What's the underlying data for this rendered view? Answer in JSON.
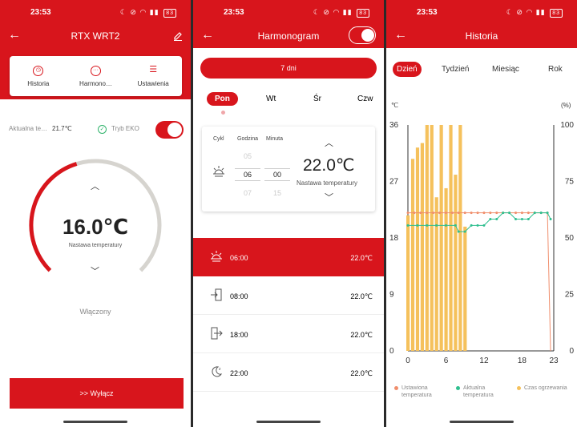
{
  "status_time": "23:53",
  "battery": "83",
  "colors": {
    "accent": "#d8151c",
    "setpoint": "#f08e6c",
    "actual": "#2fbf8f",
    "heating": "#f5c15c"
  },
  "screen1": {
    "title": "RTX WRT2",
    "tabs": [
      {
        "label": "Historia",
        "icon": "clock-icon"
      },
      {
        "label": "Harmono…",
        "icon": "dots-icon"
      },
      {
        "label": "Ustawienia",
        "icon": "menu-lines-icon"
      }
    ],
    "current_label": "Aktualna te…",
    "current_value": "21.7℃",
    "eko_label": "Tryb EKO",
    "eko_on": true,
    "setpoint": "16.0℃",
    "setpoint_label": "Nastawa temperatury",
    "state": "Włączony",
    "off_button": ">>  Wyłącz"
  },
  "screen2": {
    "title": "Harmonogram",
    "enabled": true,
    "days_button": "7 dni",
    "days": [
      "Pon",
      "Wt",
      "Śr",
      "Czw"
    ],
    "active_day": "Pon",
    "editor": {
      "col_cycle": "Cykl",
      "col_hour": "Godzina",
      "col_minute": "Minuta",
      "hour_prev": "05",
      "hour": "06",
      "hour_next": "07",
      "minute": "00",
      "minute_next": "15",
      "temp": "22.0℃",
      "temp_label": "Nastawa temperatury"
    },
    "schedule": [
      {
        "icon": "sunrise-icon",
        "time": "06:00",
        "temp": "22.0℃",
        "active": true
      },
      {
        "icon": "door-enter-icon",
        "time": "08:00",
        "temp": "22.0℃",
        "active": false
      },
      {
        "icon": "door-exit-icon",
        "time": "18:00",
        "temp": "22.0℃",
        "active": false
      },
      {
        "icon": "moon-icon",
        "time": "22:00",
        "temp": "22.0℃",
        "active": false
      }
    ]
  },
  "screen3": {
    "title": "Historia",
    "ranges": [
      "Dzień",
      "Tydzień",
      "Miesiąc",
      "Rok"
    ],
    "active_range": "Dzień",
    "legend": [
      "Ustawiona temperatura",
      "Aktualna temperatura",
      "Czas ogrzewania"
    ]
  },
  "chart_data": {
    "type": "bar",
    "left_axis_label": "℃",
    "right_axis_label": "(%)",
    "left_ylim": [
      0,
      36
    ],
    "right_ylim": [
      0,
      100
    ],
    "left_ticks": [
      "0",
      "9",
      "18",
      "27",
      "36"
    ],
    "right_ticks": [
      "0",
      "25",
      "50",
      "75",
      "100"
    ],
    "x_ticks": [
      "0",
      "6",
      "12",
      "18",
      "23"
    ],
    "xlim": [
      0,
      23
    ],
    "heating_x": [
      0,
      0.75,
      1.5,
      2.25,
      3,
      3.75,
      4.5,
      5.25,
      6,
      6.75,
      7.5,
      8.25,
      9
    ],
    "heating_pct": [
      60,
      85,
      90,
      92,
      100,
      100,
      68,
      100,
      72,
      100,
      78,
      100,
      55
    ],
    "setpoint": [
      [
        0,
        22
      ],
      [
        22,
        22
      ],
      [
        22.5,
        0
      ]
    ],
    "actual": [
      [
        0,
        20
      ],
      [
        1.5,
        20
      ],
      [
        3,
        20
      ],
      [
        4.5,
        20
      ],
      [
        6,
        20
      ],
      [
        7.5,
        20
      ],
      [
        8,
        19
      ],
      [
        9,
        19
      ],
      [
        10,
        20
      ],
      [
        11,
        20
      ],
      [
        12,
        20
      ],
      [
        13,
        21
      ],
      [
        14,
        21
      ],
      [
        15,
        22
      ],
      [
        16,
        22
      ],
      [
        17,
        21
      ],
      [
        18,
        21
      ],
      [
        19,
        21
      ],
      [
        20,
        22
      ],
      [
        21,
        22
      ],
      [
        22,
        22
      ],
      [
        22.5,
        21
      ]
    ]
  }
}
